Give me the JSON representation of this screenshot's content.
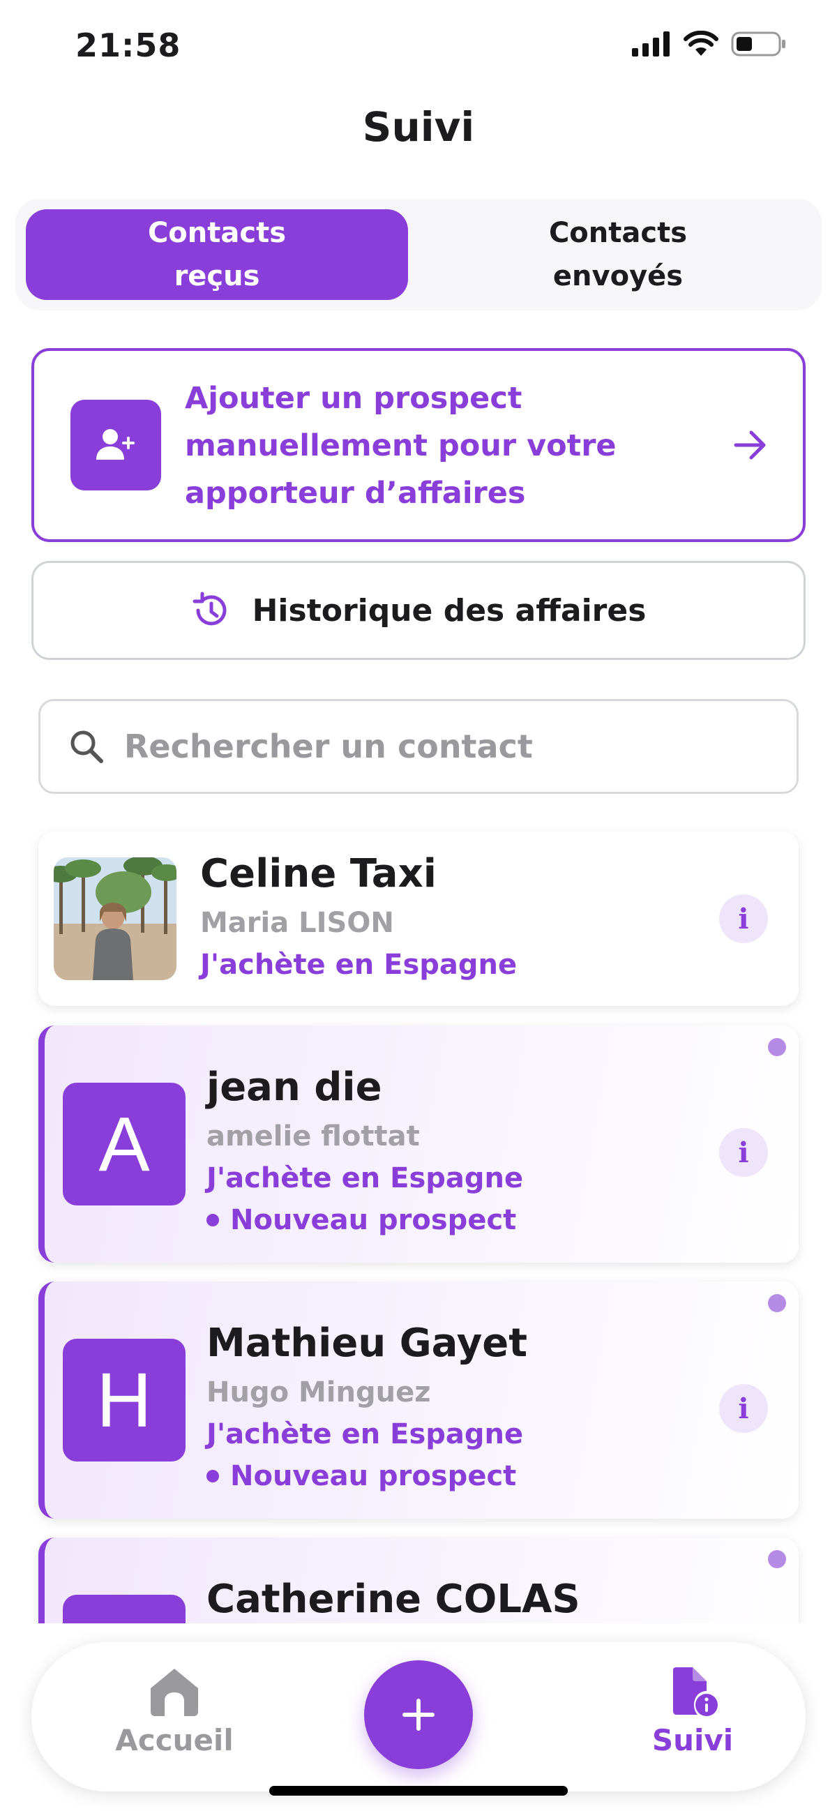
{
  "status_bar": {
    "time": "21:58"
  },
  "header": {
    "title": "Suivi"
  },
  "tabs": [
    {
      "label_line1": "Contacts",
      "label_line2": "reçus",
      "active": true
    },
    {
      "label_line1": "Contacts",
      "label_line2": "envoyés",
      "active": false
    }
  ],
  "add_prospect": {
    "line1": "Ajouter un prospect",
    "line2": "manuellement pour votre",
    "line3": "apporteur d’affaires"
  },
  "history": {
    "label": "Historique des affaires"
  },
  "search": {
    "placeholder": "Rechercher un contact",
    "value": ""
  },
  "contacts": [
    {
      "name": "Celine Taxi",
      "referrer": "Maria LISON",
      "action": "J'achète en Espagne",
      "status": "",
      "avatar": "photo"
    },
    {
      "name": "jean die",
      "referrer": "amelie flottat",
      "action": "J'achète en Espagne",
      "status": "Nouveau prospect",
      "avatar_letter": "A"
    },
    {
      "name": "Mathieu Gayet",
      "referrer": "Hugo Minguez",
      "action": "J'achète en Espagne",
      "status": "Nouveau prospect",
      "avatar_letter": "H"
    },
    {
      "name": "Catherine COLAS",
      "referrer": "",
      "action": "",
      "status": "",
      "avatar_letter": ""
    }
  ],
  "info_label": "i",
  "bottom_nav": {
    "home_label": "Accueil",
    "suivi_label": "Suivi",
    "fab_icon": "plus-icon"
  },
  "colors": {
    "accent": "#8a3ed9",
    "accent_light": "#efe5fa",
    "muted": "#9a9a9e"
  }
}
